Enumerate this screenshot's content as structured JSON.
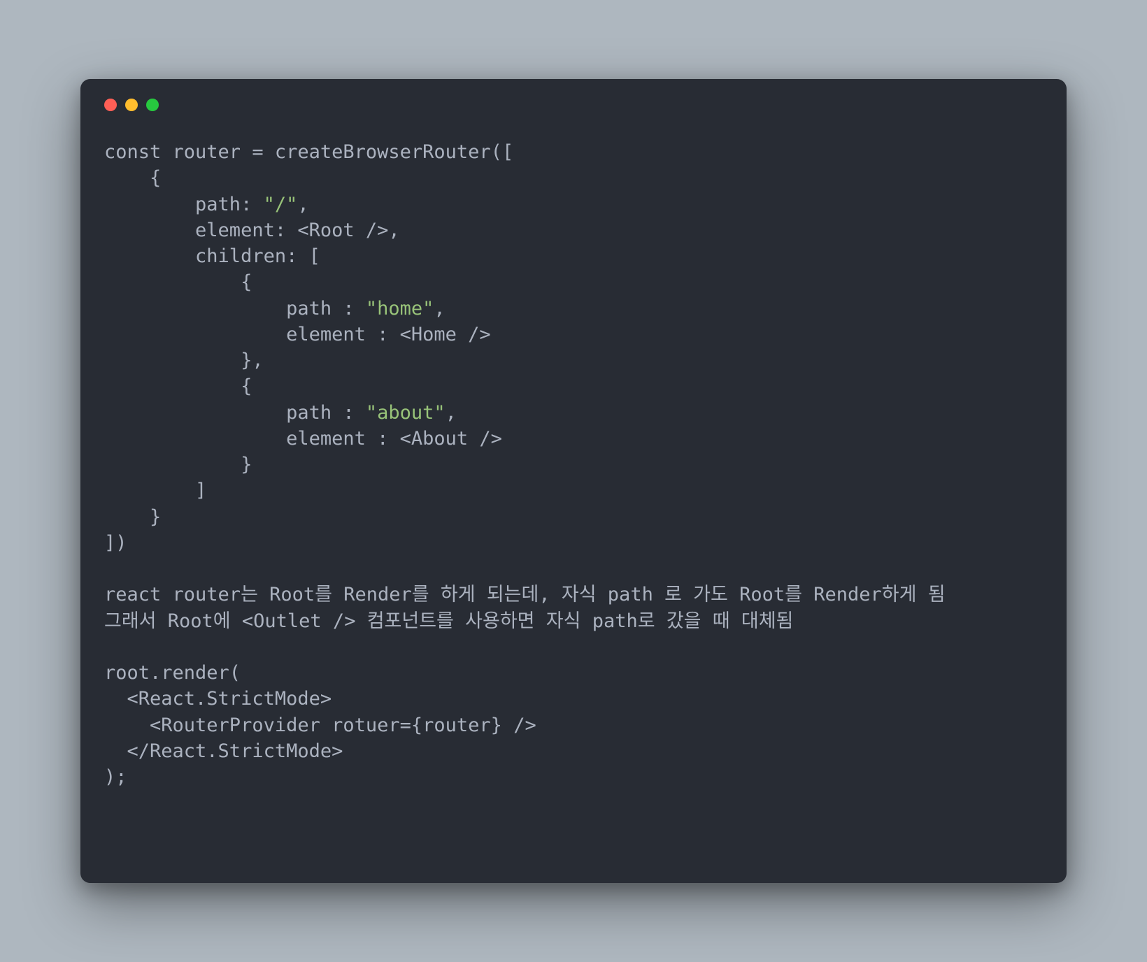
{
  "window": {
    "dots": [
      "red",
      "yellow",
      "green"
    ]
  },
  "code": {
    "l1": "const router = createBrowserRouter([",
    "l2": "    {",
    "l3a": "        path: ",
    "l3b": "\"/\"",
    "l3c": ",",
    "l4": "        element: <Root />,",
    "l5": "        children: [",
    "l6": "            {",
    "l7a": "                path : ",
    "l7b": "\"home\"",
    "l7c": ",",
    "l8": "                element : <Home />",
    "l9": "            },",
    "l10": "            {",
    "l11a": "                path : ",
    "l11b": "\"about\"",
    "l11c": ",",
    "l12": "                element : <About />",
    "l13": "            }",
    "l14": "        ]",
    "l15": "    }",
    "l16": "])",
    "l17": "",
    "l18": "react router는 Root를 Render를 하게 되는데, 자식 path 로 가도 Root를 Render하게 됨",
    "l19": "그래서 Root에 <Outlet /> 컴포넌트를 사용하면 자식 path로 갔을 때 대체됨",
    "l20": "",
    "l21": "root.render(",
    "l22": "  <React.StrictMode>",
    "l23": "    <RouterProvider rotuer={router} />",
    "l24": "  </React.StrictMode>",
    "l25": ");"
  }
}
